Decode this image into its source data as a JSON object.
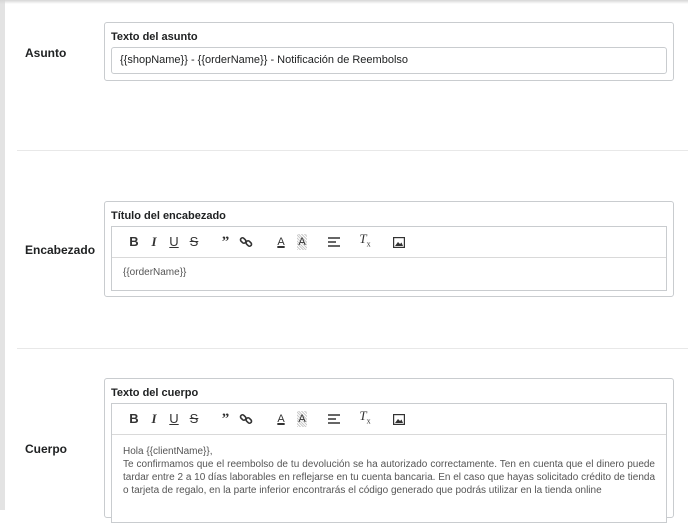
{
  "sections": {
    "subject": {
      "label": "Asunto",
      "card_title": "Texto del asunto",
      "input_value": "{{shopName}} - {{orderName}} - Notificación de Reembolso"
    },
    "header": {
      "label": "Encabezado",
      "card_title": "Título del encabezado",
      "editor_text": "{{orderName}}"
    },
    "body": {
      "label": "Cuerpo",
      "card_title": "Texto del cuerpo",
      "editor_lines": [
        "Hola {{clientName}},",
        " Te confirmamos que el reembolso de tu devolución se ha autorizado correctamente. Ten en cuenta que el dinero puede tardar entre 2 a 10 días laborables en reflejarse en tu cuenta bancaria. En el caso que hayas solicitado crédito de tienda o tarjeta de regalo, en la parte inferior encontrarás el código generado que podrás utilizar en la tienda online"
      ]
    }
  },
  "toolbar": {
    "buttons": [
      {
        "name": "bold-icon",
        "glyph": "B"
      },
      {
        "name": "italic-icon",
        "glyph": "I"
      },
      {
        "name": "underline-icon",
        "glyph": "U"
      },
      {
        "name": "strikethrough-icon",
        "glyph": "S"
      },
      {
        "name": "blockquote-icon",
        "glyph": "99"
      },
      {
        "name": "link-icon",
        "glyph": ""
      },
      {
        "name": "text-color-icon",
        "glyph": "A"
      },
      {
        "name": "background-color-icon",
        "glyph": "A"
      },
      {
        "name": "align-icon",
        "glyph": ""
      },
      {
        "name": "clear-format-icon",
        "glyph": "Tx"
      },
      {
        "name": "image-icon",
        "glyph": ""
      }
    ]
  }
}
